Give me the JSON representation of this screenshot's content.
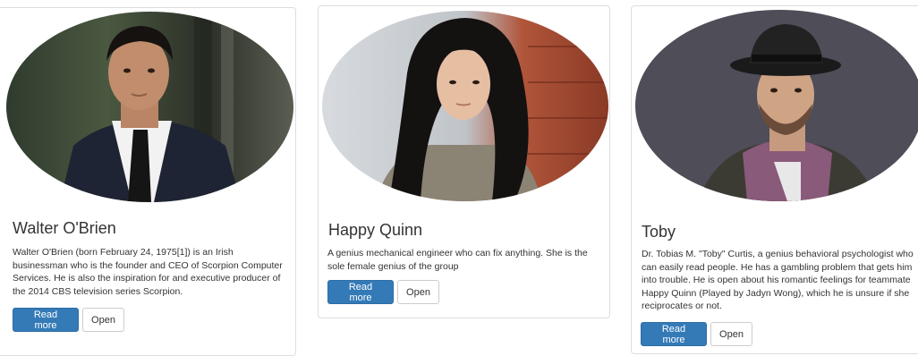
{
  "cards": [
    {
      "name": "Walter O'Brien",
      "description": "Walter O'Brien (born February 24, 1975[1]) is an Irish businessman who is the founder and CEO of Scorpion Computer Services. He is also the inspiration for and executive producer of the 2014 CBS television series Scorpion.",
      "read_more_label": "Read more",
      "open_label": "Open"
    },
    {
      "name": "Happy Quinn",
      "description": "A genius mechanical engineer who can fix anything. She is the sole female genius of the group",
      "read_more_label": "Read more",
      "open_label": "Open"
    },
    {
      "name": "Toby",
      "description": "Dr. Tobias M. \"Toby\" Curtis, a genius behavioral psychologist who can easily read people. He has a gambling problem that gets him into trouble. He is open about his romantic feelings for teammate Happy Quinn (Played by Jadyn Wong), which he is unsure if she reciprocates or not.",
      "read_more_label": "Read more",
      "open_label": "Open"
    }
  ],
  "colors": {
    "primary_button": "#337ab7",
    "card_border": "#dddddd"
  }
}
